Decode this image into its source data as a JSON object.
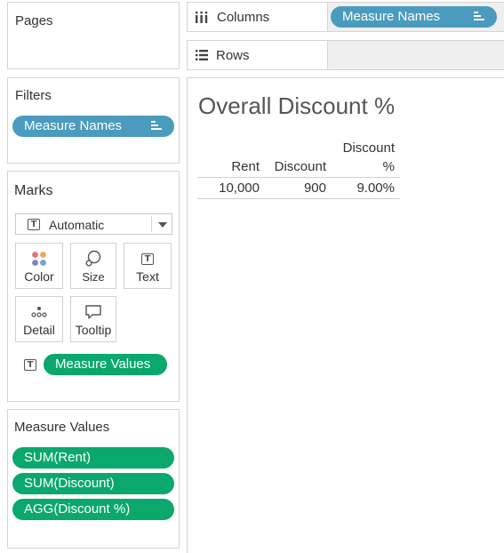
{
  "pages": {
    "title": "Pages"
  },
  "filters": {
    "title": "Filters",
    "pill": "Measure Names"
  },
  "marks": {
    "title": "Marks",
    "mark_type": "Automatic",
    "buttons": {
      "color": "Color",
      "size": "Size",
      "text": "Text",
      "detail": "Detail",
      "tooltip": "Tooltip"
    },
    "text_pill": "Measure Values"
  },
  "measure_values": {
    "title": "Measure Values",
    "items": [
      "SUM(Rent)",
      "SUM(Discount)",
      "AGG(Discount %)"
    ]
  },
  "shelves": {
    "columns_label": "Columns",
    "columns_pill": "Measure Names",
    "rows_label": "Rows"
  },
  "view": {
    "title": "Overall Discount %",
    "headers": {
      "rent": "Rent",
      "discount": "Discount",
      "discount_pct_line1": "Discount",
      "discount_pct_line2": "%"
    },
    "row": {
      "rent": "10,000",
      "discount": "900",
      "discount_pct": "9.00%"
    }
  },
  "colors": {
    "measure_names_pill": "#4b9bbf",
    "measure_values_pill": "#0aa86d"
  },
  "icons": {
    "columns": "columns-icon",
    "rows": "rows-icon",
    "sort": "sort-icon",
    "text_mark": "text-mark-icon"
  }
}
